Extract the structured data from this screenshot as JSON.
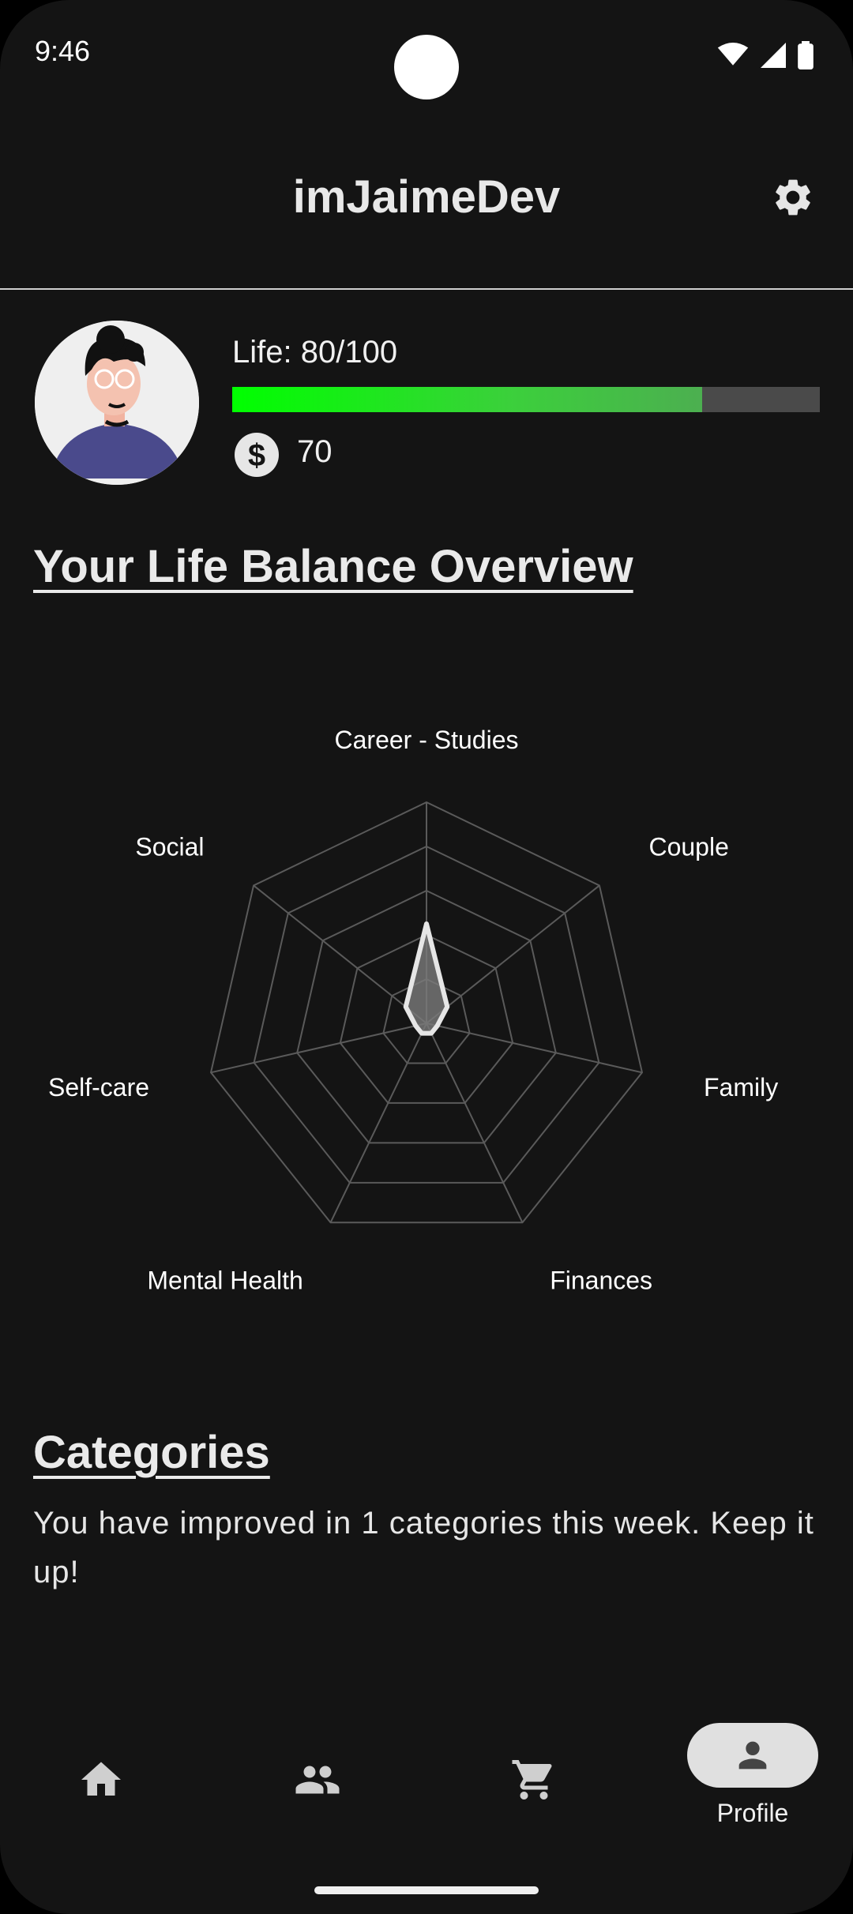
{
  "status": {
    "time": "9:46"
  },
  "header": {
    "title": "imJaimeDev"
  },
  "profile": {
    "life_label": "Life: 80/100",
    "life_value": 80,
    "life_max": 100,
    "coins": "70"
  },
  "overview": {
    "heading": "Your Life Balance Overview",
    "chart_data": {
      "type": "radar",
      "axes": [
        "Career - Studies",
        "Couple",
        "Family",
        "Finances",
        "Mental Health",
        "Self-care",
        "Social"
      ],
      "values": [
        0.45,
        0.12,
        0.05,
        0.05,
        0.05,
        0.05,
        0.12
      ],
      "range": [
        0,
        1
      ],
      "rings": 5,
      "colors": {
        "grid": "#5a5a5a",
        "fill": "#7a7a7a",
        "stroke": "#e6e6e6"
      }
    }
  },
  "categories": {
    "heading": "Categories",
    "text": "You have improved in 1 categories this week. Keep it up!"
  },
  "nav": {
    "items": [
      {
        "icon": "home-icon",
        "label": ""
      },
      {
        "icon": "group-icon",
        "label": ""
      },
      {
        "icon": "cart-icon",
        "label": ""
      },
      {
        "icon": "person-icon",
        "label": "Profile",
        "active": true
      }
    ]
  },
  "colors": {
    "background": "#141414",
    "life_bar": "#00ff00",
    "pill": "#e0e0e0"
  }
}
